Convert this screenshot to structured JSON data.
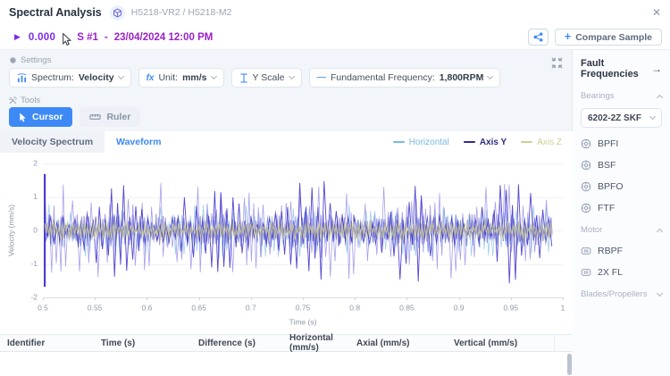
{
  "window": {
    "title": "Spectral Analysis",
    "machine_id": "H5218-VR2 / H5218-M2",
    "close_label": "✕"
  },
  "toolbar": {
    "play_value": "0.000",
    "sample_id": "S #1",
    "separator": "-",
    "sample_datetime": "23/04/2024 12:00 PM",
    "compare_plus": "+",
    "compare_label": "Compare Sample"
  },
  "settings": {
    "label": "Settings",
    "dropdowns": [
      {
        "icon": "spectrum-chart-icon",
        "label": "Spectrum:",
        "value": "Velocity"
      },
      {
        "icon": "fx-icon",
        "label": "Unit:",
        "value": "mm/s"
      },
      {
        "icon": "y-scale-icon",
        "label": "Y Scale",
        "value": ""
      },
      {
        "icon": "fundamental-dash-icon",
        "label": "Fundamental Frequency:",
        "value": "1,800RPM"
      }
    ]
  },
  "tools": {
    "label": "Tools",
    "cursor_label": "Cursor",
    "ruler_label": "Ruler"
  },
  "tabs": [
    {
      "label": "Velocity Spectrum",
      "active": false
    },
    {
      "label": "Waveform",
      "active": true
    }
  ],
  "legend": [
    {
      "label": "Horizontal",
      "color": "#7ab9e4"
    },
    {
      "label": "Axis Y",
      "color": "#2e2c80"
    },
    {
      "label": "Axis Z",
      "color": "#cfcf92"
    }
  ],
  "chart_data": {
    "type": "line",
    "title": "Waveform",
    "xlabel": "Time (s)",
    "ylabel": "Velocity (mm/s)",
    "xlim": [
      0.5,
      1
    ],
    "ylim": [
      -2,
      2
    ],
    "xticks": {
      "values": [
        0.5,
        0.55,
        0.6,
        0.65,
        0.7,
        0.75,
        0.8,
        0.85,
        0.9,
        0.95,
        1
      ],
      "labels": [
        "0.5",
        "0.55",
        "0.6",
        "0.65",
        "0.7",
        "0.75",
        "0.8",
        "0.85",
        "0.9",
        "0.95",
        "1"
      ]
    },
    "yticks": {
      "values": [
        2,
        1,
        0,
        -1,
        -2
      ],
      "labels": [
        "2",
        "1",
        "0",
        "-1",
        "-2"
      ]
    },
    "grid": true,
    "legend_position": "top-right",
    "x_data_end": 0.99,
    "series": [
      {
        "name": "Horizontal",
        "color": "#92c4ea",
        "peak_amplitude": 0.8,
        "visible": true
      },
      {
        "name": "Axis Y",
        "color": "#4a3ecf",
        "light_color": "#8a82e4",
        "core_color": "#3c33bd",
        "peak_amplitude": 1.7,
        "visible": true
      },
      {
        "name": "Axis Z",
        "color": "#c9c88e",
        "peak_amplitude": 0.26,
        "visible": true
      }
    ]
  },
  "table": {
    "headers": [
      "Identifier",
      "Time (s)",
      "Difference (s)",
      "Horizontal (mm/s)",
      "Axial (mm/s)",
      "Vertical (mm/s)"
    ],
    "rows": []
  },
  "sidebar": {
    "title": "Fault Frequencies",
    "arrow": "→",
    "sections": [
      {
        "label": "Bearings",
        "collapsed": false,
        "select_value": "6202-2Z SKF",
        "items": [
          {
            "icon": "bearing-icon",
            "label": "BPFI"
          },
          {
            "icon": "bearing-icon",
            "label": "BSF"
          },
          {
            "icon": "bearing-icon",
            "label": "BPFO"
          },
          {
            "icon": "bearing-icon",
            "label": "FTF"
          }
        ]
      },
      {
        "label": "Motor",
        "collapsed": false,
        "items": [
          {
            "icon": "motor-icon",
            "label": "RBPF"
          },
          {
            "icon": "motor-icon",
            "label": "2X FL"
          }
        ]
      },
      {
        "label": "Blades/Propellers",
        "collapsed": true,
        "items": []
      }
    ]
  }
}
